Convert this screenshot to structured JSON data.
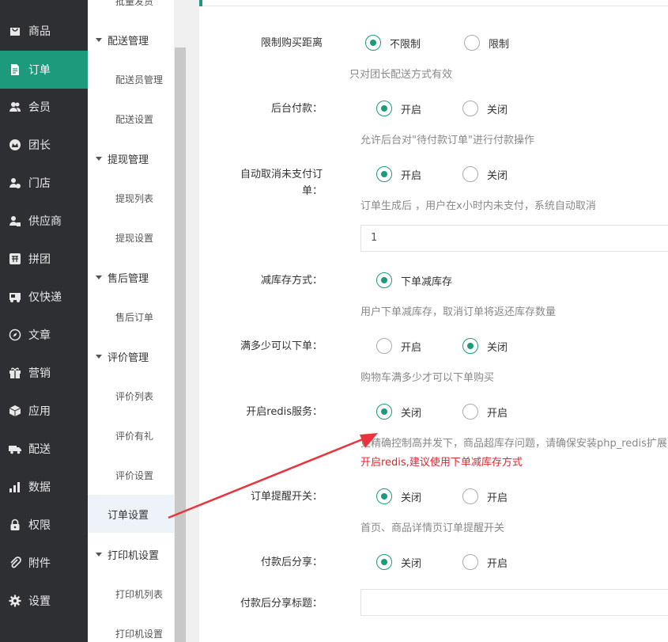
{
  "main_nav": [
    {
      "label": "商品",
      "icon": "shopping-bag-icon"
    },
    {
      "label": "订单",
      "icon": "order-document-icon",
      "active": true
    },
    {
      "label": "会员",
      "icon": "members-icon"
    },
    {
      "label": "团长",
      "icon": "crown-icon"
    },
    {
      "label": "门店",
      "icon": "store-user-icon"
    },
    {
      "label": "供应商",
      "icon": "supplier-user-icon"
    },
    {
      "label": "拼团",
      "icon": "pintuan-icon"
    },
    {
      "label": "仅快递",
      "icon": "truck-store-icon"
    },
    {
      "label": "文章",
      "icon": "compass-icon"
    },
    {
      "label": "营销",
      "icon": "gift-icon"
    },
    {
      "label": "应用",
      "icon": "cube-icon"
    },
    {
      "label": "配送",
      "icon": "delivery-truck-icon"
    },
    {
      "label": "数据",
      "icon": "bar-chart-icon"
    },
    {
      "label": "权限",
      "icon": "lock-icon"
    },
    {
      "label": "附件",
      "icon": "paperclip-icon"
    },
    {
      "label": "设置",
      "icon": "gear-icon"
    }
  ],
  "sub_nav": {
    "top_partial": "批量发货",
    "groups": [
      {
        "title": "配送管理",
        "items": [
          "配送员管理",
          "配送设置"
        ]
      },
      {
        "title": "提现管理",
        "items": [
          "提现列表",
          "提现设置"
        ]
      },
      {
        "title": "售后管理",
        "items": [
          "售后订单"
        ]
      },
      {
        "title": "评价管理",
        "items": [
          "评价列表",
          "评价有礼",
          "评价设置"
        ]
      },
      {
        "title": "打印机设置",
        "items": [
          "打印机列表",
          "打印机设置"
        ]
      }
    ],
    "active": "订单设置"
  },
  "settings": {
    "limit_distance": {
      "label": "限制购买距离",
      "options": [
        "不限制",
        "限制"
      ],
      "selected": "不限制",
      "help": "只对团长配送方式有效"
    },
    "backend_pay": {
      "label": "后台付款：",
      "options": [
        "开启",
        "关闭"
      ],
      "selected": "开启",
      "help": "允许后台对\"待付款订单\"进行付款操作"
    },
    "auto_cancel": {
      "label": "自动取消未支付订单：",
      "options": [
        "开启",
        "关闭"
      ],
      "selected": "开启",
      "help": "订单生成后 ，用户在x小时内未支付，系统自动取消",
      "value": "1"
    },
    "stock_reduce": {
      "label": "减库存方式：",
      "options": [
        "下单减库存"
      ],
      "selected": "下单减库存",
      "help": "用户下单减库存，取消订单将返还库存数量"
    },
    "min_amount": {
      "label": "满多少可以下单：",
      "options": [
        "开启",
        "关闭"
      ],
      "selected": "关闭",
      "help": "购物车满多少才可以下单购买"
    },
    "redis": {
      "label": "开启redis服务：",
      "options": [
        "关闭",
        "开启"
      ],
      "selected": "关闭",
      "help": "更精确控制高并发下，商品超库存问题，请确保安装php_redis扩展",
      "warning": "开启redis,建议使用下单减库存方式"
    },
    "order_reminder": {
      "label": "订单提醒开关：",
      "options": [
        "关闭",
        "开启"
      ],
      "selected": "关闭",
      "help": "首页、商品详情页订单提醒开关"
    },
    "share_after_pay": {
      "label": "付款后分享：",
      "options": [
        "关闭",
        "开启"
      ],
      "selected": "关闭"
    },
    "share_title": {
      "label": "付款后分享标题：",
      "value": ""
    }
  },
  "annotation_color": "#e8343a",
  "accent_color": "#1d9a7c"
}
